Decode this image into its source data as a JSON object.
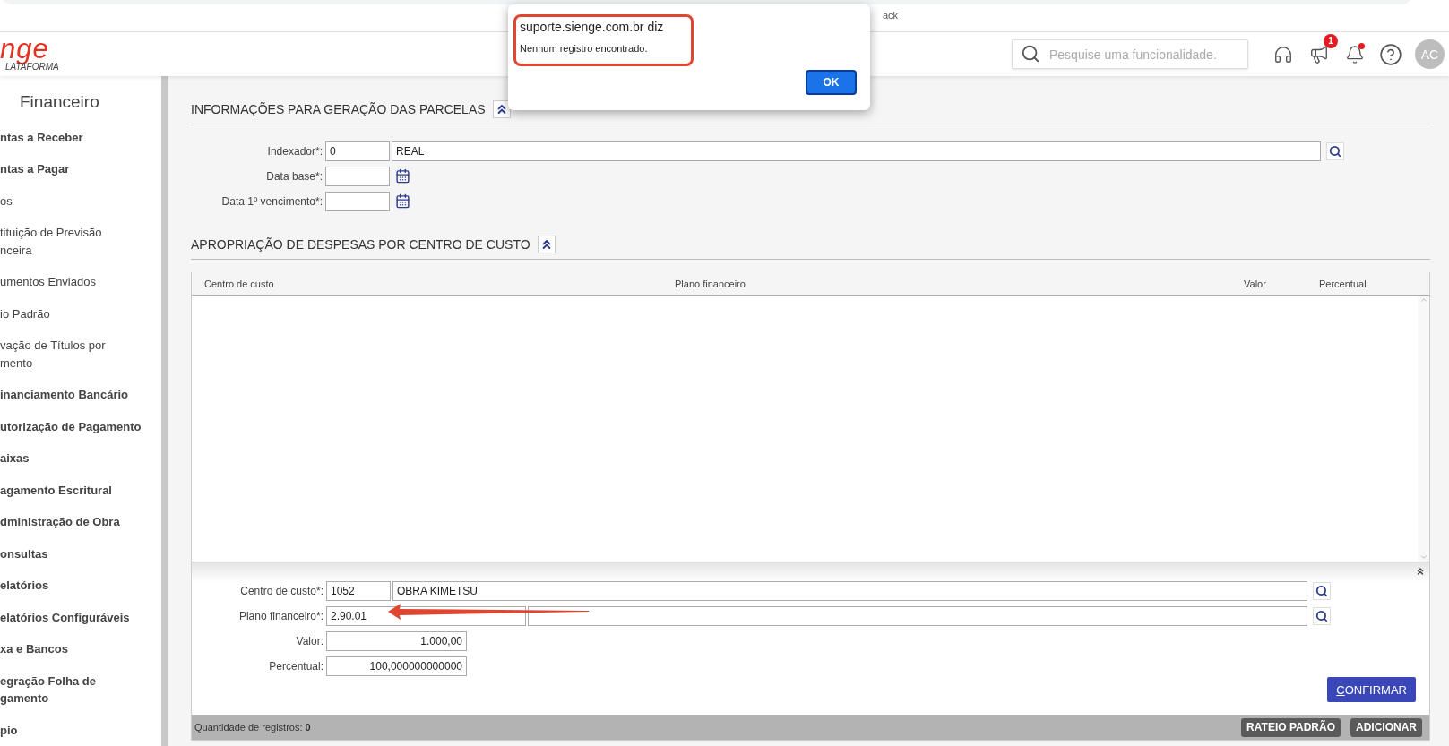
{
  "browser": {
    "tab_text": "ack"
  },
  "header": {
    "logo": {
      "mark": "nge",
      "sub": "LATAFORMA"
    },
    "search": {
      "placeholder": "Pesquise uma funcionalidade."
    },
    "announcements_badge": "1",
    "alerts_unread": true,
    "avatar": "AC"
  },
  "sidebar": {
    "title": "Financeiro",
    "items": [
      {
        "label": "ntas a Receber",
        "bold": true
      },
      {
        "label": "ntas a Pagar",
        "bold": true
      },
      {
        "label": "os",
        "bold": false
      },
      {
        "label": "tituição de Previsão\nnceira",
        "bold": false
      },
      {
        "label": "umentos Enviados",
        "bold": false
      },
      {
        "label": "io Padrão",
        "bold": false
      },
      {
        "label": "vação de Títulos por\nmento",
        "bold": false
      },
      {
        "label": "inanciamento Bancário",
        "bold": true
      },
      {
        "label": "utorização de Pagamento",
        "bold": true
      },
      {
        "label": "aixas",
        "bold": true
      },
      {
        "label": "agamento Escritural",
        "bold": true
      },
      {
        "label": "dministração de Obra",
        "bold": true
      },
      {
        "label": "onsultas",
        "bold": true
      },
      {
        "label": "elatórios",
        "bold": true
      },
      {
        "label": "elatórios Configuráveis",
        "bold": true
      },
      {
        "label": "xa e Bancos",
        "bold": true
      },
      {
        "label": "egração Folha de\ngamento",
        "bold": true
      },
      {
        "label": "pio",
        "bold": true
      }
    ]
  },
  "installments": {
    "title": "INFORMAÇÕES PARA GERAÇÃO DAS PARCELAS",
    "expanded": true,
    "fields": [
      {
        "label": "Indexador*:",
        "kind": "lookup",
        "code": "0",
        "description": "REAL"
      },
      {
        "label": "Data base*:",
        "kind": "date"
      },
      {
        "label": "Data 1º vencimento*:",
        "kind": "date"
      }
    ]
  },
  "allocation": {
    "title": "APROPRIAÇÃO DE DESPESAS POR CENTRO DE CUSTO",
    "expanded": true,
    "table": {
      "columns": [
        "Centro de custo",
        "Plano financeiro",
        "Valor",
        "Percentual"
      ]
    },
    "form": {
      "expanded": true,
      "fields": [
        {
          "label": "Centro de custo*:",
          "kind": "lookup",
          "code": "1052",
          "description": "OBRA KIMETSU"
        },
        {
          "label": "Plano financeiro*:",
          "kind": "lookup-wide",
          "code": "2.90.01"
        },
        {
          "label": "Valor:",
          "kind": "number",
          "value": "1.000,00"
        },
        {
          "label": "Percentual:",
          "kind": "number",
          "value": "100,000000000000"
        }
      ],
      "confirm_button": "CONFIRMAR"
    },
    "footer": {
      "count_text": "Quantidade de registros: **0**",
      "buttons": [
        "RATEIO PADRÃO",
        "ADICIONAR"
      ]
    }
  },
  "dialog": {
    "title": "suporte.sienge.com.br diz",
    "message": "Nenhum registro encontrado.",
    "button": "OK"
  }
}
